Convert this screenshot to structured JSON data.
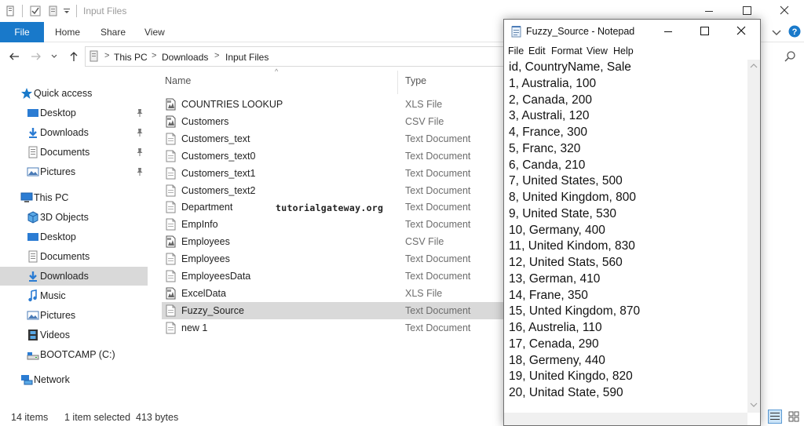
{
  "explorer": {
    "title": "Input Files",
    "ribbon_tabs": [
      "File",
      "Home",
      "Share",
      "View"
    ],
    "breadcrumb": [
      "This PC",
      "Downloads",
      "Input Files"
    ],
    "columns": {
      "name": "Name",
      "type": "Type"
    },
    "sidebar": [
      {
        "label": "Quick access",
        "icon": "star-icon",
        "level": 0,
        "pinned": false
      },
      {
        "label": "Desktop",
        "icon": "desktop-folder-icon",
        "level": 1,
        "pinned": true
      },
      {
        "label": "Downloads",
        "icon": "download-arrow-icon",
        "level": 1,
        "pinned": true
      },
      {
        "label": "Documents",
        "icon": "documents-icon",
        "level": 1,
        "pinned": true
      },
      {
        "label": "Pictures",
        "icon": "pictures-icon",
        "level": 1,
        "pinned": true
      },
      {
        "label": "This PC",
        "icon": "computer-icon",
        "level": 0,
        "pinned": false
      },
      {
        "label": "3D Objects",
        "icon": "cube-icon",
        "level": 1,
        "pinned": false
      },
      {
        "label": "Desktop",
        "icon": "desktop-folder-icon",
        "level": 1,
        "pinned": false
      },
      {
        "label": "Documents",
        "icon": "documents-icon",
        "level": 1,
        "pinned": false
      },
      {
        "label": "Downloads",
        "icon": "download-arrow-icon",
        "level": 1,
        "pinned": false,
        "selected": true
      },
      {
        "label": "Music",
        "icon": "music-note-icon",
        "level": 1,
        "pinned": false
      },
      {
        "label": "Pictures",
        "icon": "pictures-icon",
        "level": 1,
        "pinned": false
      },
      {
        "label": "Videos",
        "icon": "film-icon",
        "level": 1,
        "pinned": false
      },
      {
        "label": "BOOTCAMP (C:)",
        "icon": "drive-icon",
        "level": 1,
        "pinned": false
      },
      {
        "label": "Network",
        "icon": "network-icon",
        "level": 0,
        "pinned": false
      }
    ],
    "files": [
      {
        "name": "COUNTRIES LOOKUP",
        "type": "XLS File",
        "icon": "spreadsheet-file-icon"
      },
      {
        "name": "Customers",
        "type": "CSV File",
        "icon": "spreadsheet-file-icon"
      },
      {
        "name": "Customers_text",
        "type": "Text Document",
        "icon": "text-file-icon"
      },
      {
        "name": "Customers_text0",
        "type": "Text Document",
        "icon": "text-file-icon"
      },
      {
        "name": "Customers_text1",
        "type": "Text Document",
        "icon": "text-file-icon"
      },
      {
        "name": "Customers_text2",
        "type": "Text Document",
        "icon": "text-file-icon"
      },
      {
        "name": "Department",
        "type": "Text Document",
        "icon": "text-file-icon"
      },
      {
        "name": "EmpInfo",
        "type": "Text Document",
        "icon": "text-file-icon"
      },
      {
        "name": "Employees",
        "type": "CSV File",
        "icon": "spreadsheet-file-icon"
      },
      {
        "name": "Employees",
        "type": "Text Document",
        "icon": "text-file-icon"
      },
      {
        "name": "EmployeesData",
        "type": "Text Document",
        "icon": "text-file-icon"
      },
      {
        "name": "ExcelData",
        "type": "XLS File",
        "icon": "spreadsheet-file-icon"
      },
      {
        "name": "Fuzzy_Source",
        "type": "Text Document",
        "icon": "text-file-icon",
        "selected": true
      },
      {
        "name": "new 1",
        "type": "Text Document",
        "icon": "text-file-icon"
      }
    ],
    "watermark": "tutorialgateway.org",
    "status": {
      "items": "14 items",
      "selected": "1 item selected",
      "size": "413 bytes"
    }
  },
  "notepad": {
    "title": "Fuzzy_Source - Notepad",
    "menu": [
      "File",
      "Edit",
      "Format",
      "View",
      "Help"
    ],
    "lines": [
      "id, CountryName, Sale",
      "1, Australia, 100",
      "2, Canada, 200",
      "3, Australi, 120",
      "4, France, 300",
      "5, Franc, 320",
      "6, Canda, 210",
      "7, United States, 500",
      "8, United Kingdom, 800",
      "9, United State, 530",
      "10, Germany, 400",
      "11, United Kindom, 830",
      "12, United Stats, 560",
      "13, German, 410",
      "14, Frane, 350",
      "15, Unted Kingdom, 870",
      "16, Austrelia, 110",
      "17, Cenada, 290",
      "18, Germeny, 440",
      "19, United Kingdo, 820",
      "20, Unitad State, 590"
    ]
  },
  "colors": {
    "accent": "#1979ca",
    "selection": "#d9d9d9",
    "folder_blue": "#2b7cd3",
    "secondary_text": "#6d6d6d"
  }
}
